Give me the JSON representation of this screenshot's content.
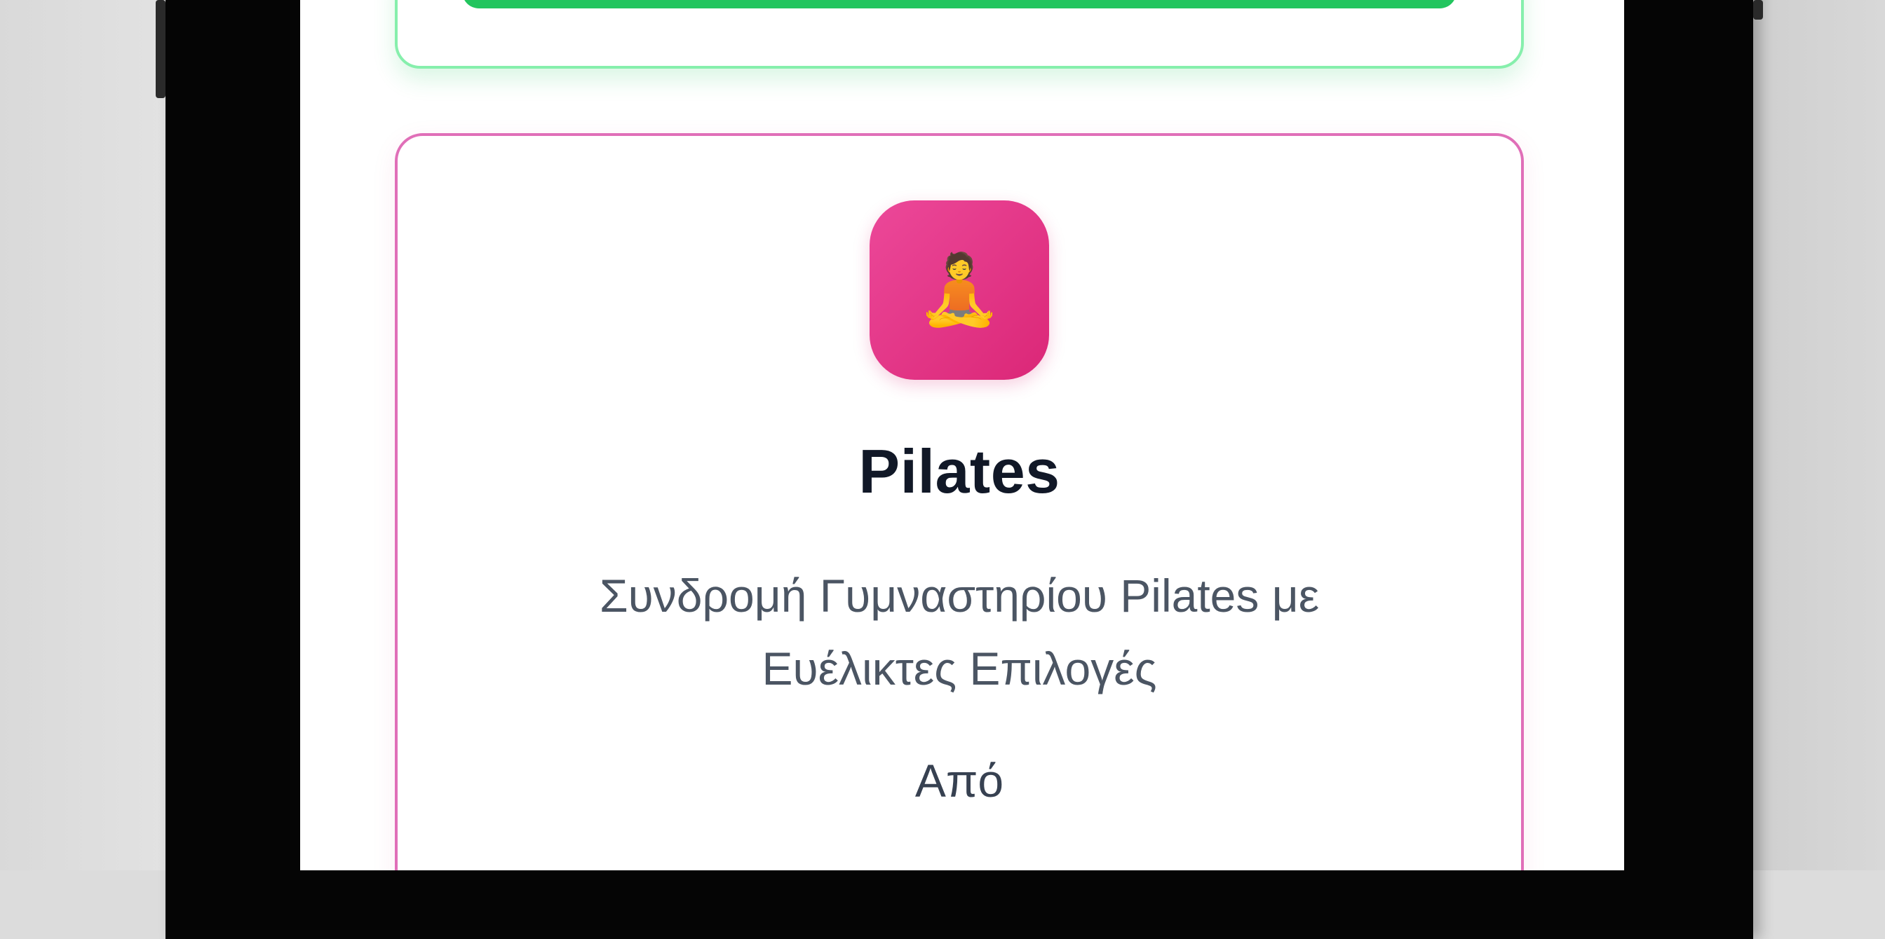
{
  "plans": {
    "pilates": {
      "icon": "person-in-lotus-position-icon",
      "icon_glyph": "🧘",
      "title": "Pilates",
      "subtitle": "Συνδρομή Γυμναστηρίου Pilates με Ευέλικτες Επιλογές",
      "price_prefix": "Από",
      "accent_color": "#db2777",
      "border_color": "#e06fb8"
    },
    "previous_card": {
      "accent_color": "#22c55e",
      "border_color": "#86efac"
    }
  }
}
